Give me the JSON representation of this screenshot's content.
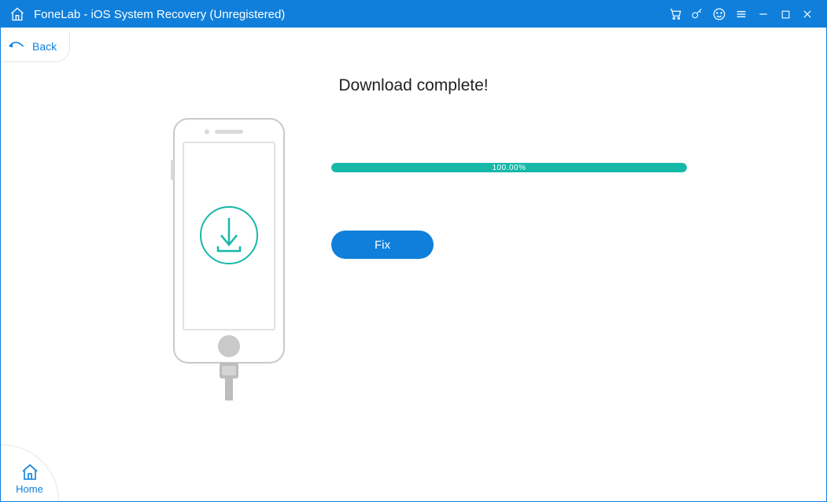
{
  "window": {
    "title": "FoneLab - iOS System Recovery (Unregistered)"
  },
  "nav": {
    "back_label": "Back",
    "home_label": "Home"
  },
  "main": {
    "headline": "Download complete!",
    "progress_percent": "100.00%",
    "fix_button_label": "Fix"
  },
  "colors": {
    "primary": "#0f7fdb",
    "accent": "#16b8a8"
  }
}
